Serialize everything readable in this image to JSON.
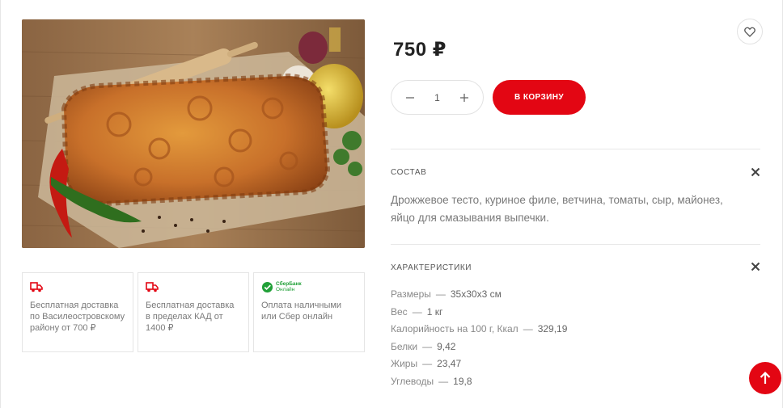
{
  "product": {
    "price": "750 ₽",
    "quantity": "1",
    "cart_button": "В КОРЗИНУ",
    "favorite_icon": "heart-icon",
    "image_icon": "pie-photo"
  },
  "info_cards": [
    {
      "icon": "delivery-truck-icon",
      "text": "Бесплатная доставка по Василеостровскому району от 700 ₽"
    },
    {
      "icon": "delivery-truck-icon",
      "text": "Бесплатная доставка в пределах КАД от 1400 ₽"
    },
    {
      "icon": "sber-logo",
      "logo_line1": "СберБанк",
      "logo_line2": "Онлайн",
      "text": "Оплата наличными или Сбер онлайн"
    }
  ],
  "composition": {
    "title": "СОСТАВ",
    "text": "Дрожжевое тесто, куриное филе, ветчина, томаты, сыр, майонез, яйцо для смазывания выпечки."
  },
  "characteristics": {
    "title": "ХАРАКТЕРИСТИКИ",
    "items": [
      {
        "label": "Размеры",
        "value": "35x30x3 см"
      },
      {
        "label": "Вес",
        "value": "1 кг"
      },
      {
        "label": "Калорийность на 100 г, Ккал",
        "value": "329,19"
      },
      {
        "label": "Белки",
        "value": "9,42"
      },
      {
        "label": "Жиры",
        "value": "23,47"
      },
      {
        "label": "Углеводы",
        "value": "19,8"
      }
    ]
  },
  "colors": {
    "accent": "#e30613",
    "sber_green": "#21a038"
  }
}
